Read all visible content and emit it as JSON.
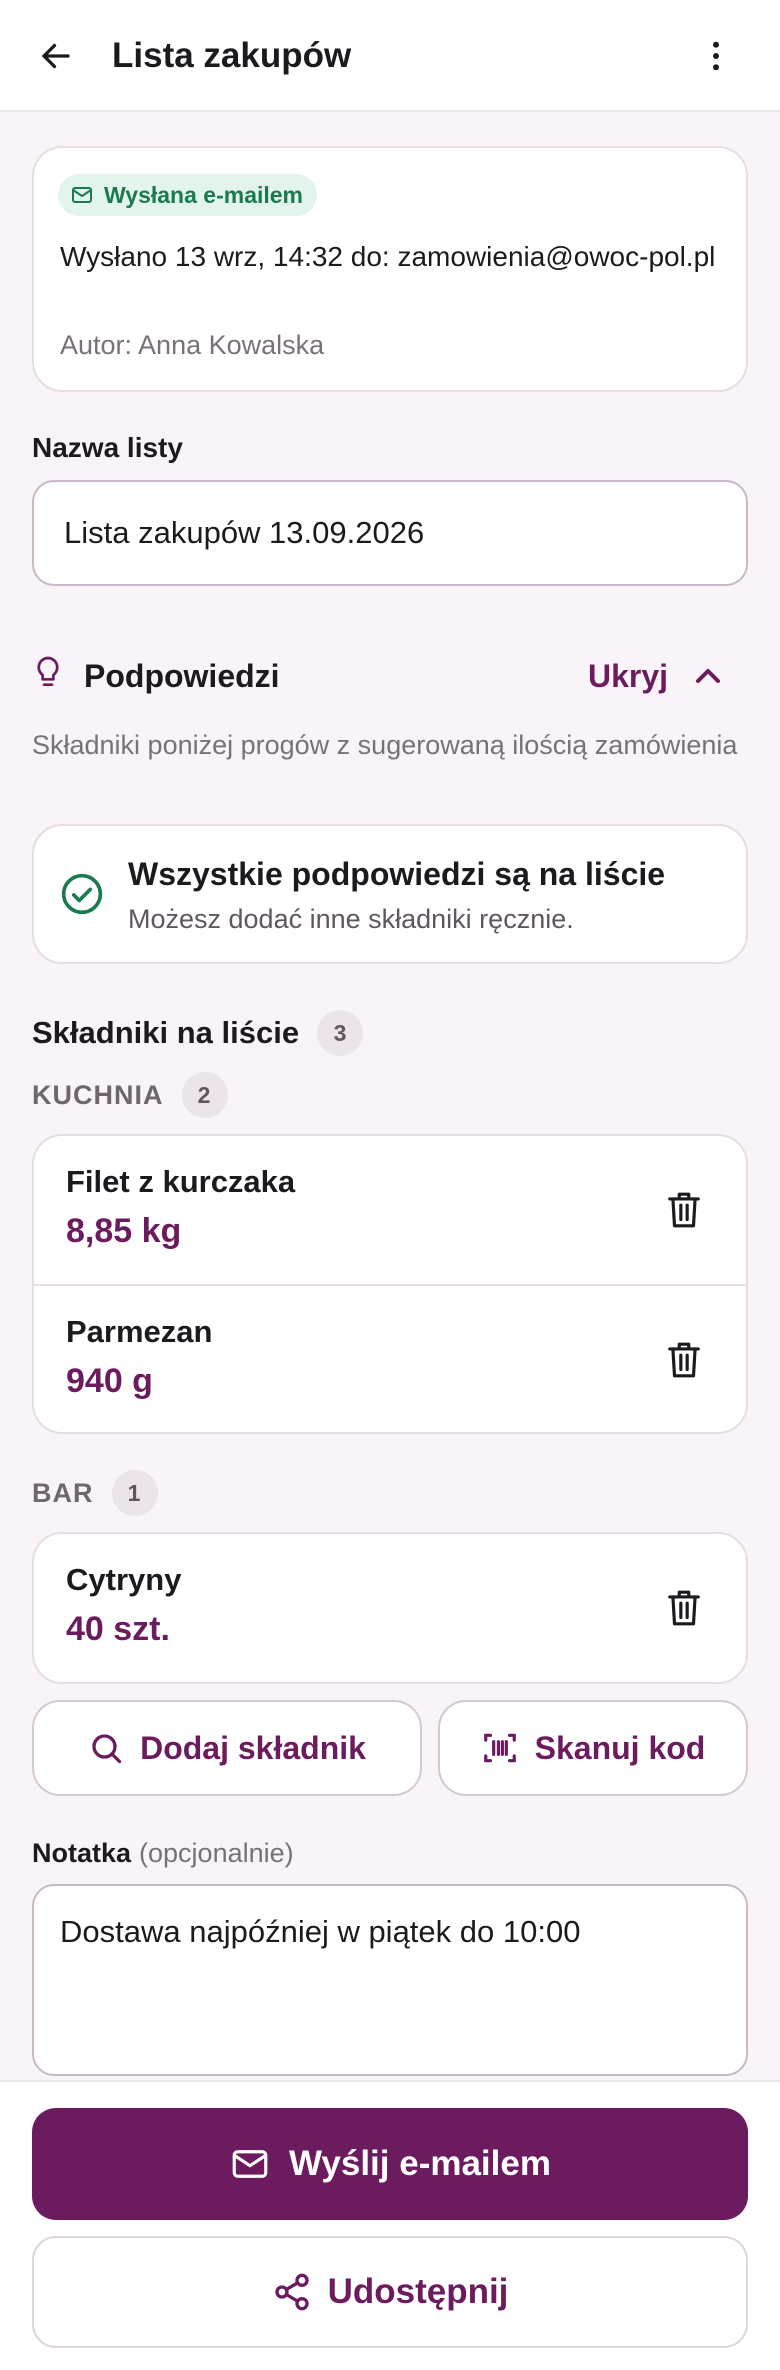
{
  "appbar": {
    "title": "Lista zakupów",
    "back_icon": "arrow-left-icon",
    "more_icon": "more-vertical-icon"
  },
  "sent_card": {
    "badge_label": "Wysłana e-mailem",
    "sent_line": "Wysłano 13 wrz, 14:32 do: zamowienia@owoc-pol.pl",
    "author_line": "Autor: Anna Kowalska"
  },
  "list_name": {
    "label": "Nazwa listy",
    "value": "Lista zakupów 13.09.2026"
  },
  "hints": {
    "title": "Podpowiedzi",
    "toggle_label": "Ukryj",
    "description": "Składniki poniżej progów z sugerowaną ilością zamówienia",
    "all_done_title": "Wszystkie podpowiedzi są na liście",
    "all_done_subtitle": "Możesz dodać inne składniki ręcznie."
  },
  "ingredients": {
    "title": "Składniki na liście",
    "count": "3",
    "groups": [
      {
        "name": "KUCHNIA",
        "count": "2",
        "items": [
          {
            "name": "Filet z kurczaka",
            "qty": "8,85 kg"
          },
          {
            "name": "Parmezan",
            "qty": "940 g"
          }
        ]
      },
      {
        "name": "BAR",
        "count": "1",
        "items": [
          {
            "name": "Cytryny",
            "qty": "40 szt."
          }
        ]
      }
    ]
  },
  "actions": {
    "add_label": "Dodaj składnik",
    "scan_label": "Skanuj kod"
  },
  "note": {
    "label": "Notatka",
    "optional": "(opcjonalnie)",
    "value": "Dostawa najpóźniej w piątek do 10:00"
  },
  "bottom": {
    "send_label": "Wyślij e-mailem",
    "share_label": "Udostępnij"
  },
  "colors": {
    "primary": "#6b1b5e",
    "success": "#1c7a4f",
    "background": "#f9f4f8"
  }
}
